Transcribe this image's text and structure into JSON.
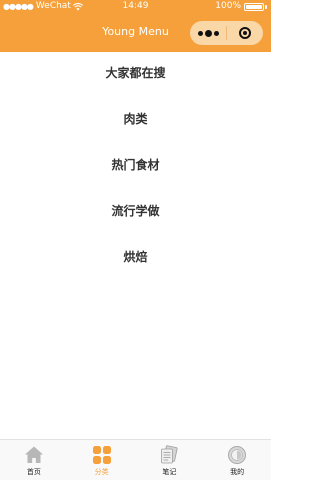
{
  "status_bar": {
    "signal_dots": "●●●●●",
    "carrier": "WeChat",
    "time": "14:49",
    "battery": "100%"
  },
  "nav": {
    "title": "Young Menu"
  },
  "categories": [
    {
      "label": "大家都在搜"
    },
    {
      "label": "肉类"
    },
    {
      "label": "热门食材"
    },
    {
      "label": "流行学做"
    },
    {
      "label": "烘焙"
    }
  ],
  "tabbar": {
    "active_color": "#f5a03a",
    "items": [
      {
        "label": "首页",
        "icon": "home-icon"
      },
      {
        "label": "分类",
        "icon": "category-icon"
      },
      {
        "label": "笔记",
        "icon": "notes-icon"
      },
      {
        "label": "我的",
        "icon": "profile-icon"
      }
    ]
  },
  "colors": {
    "header": "#f5a03a",
    "capsule": "#fad7a6"
  }
}
